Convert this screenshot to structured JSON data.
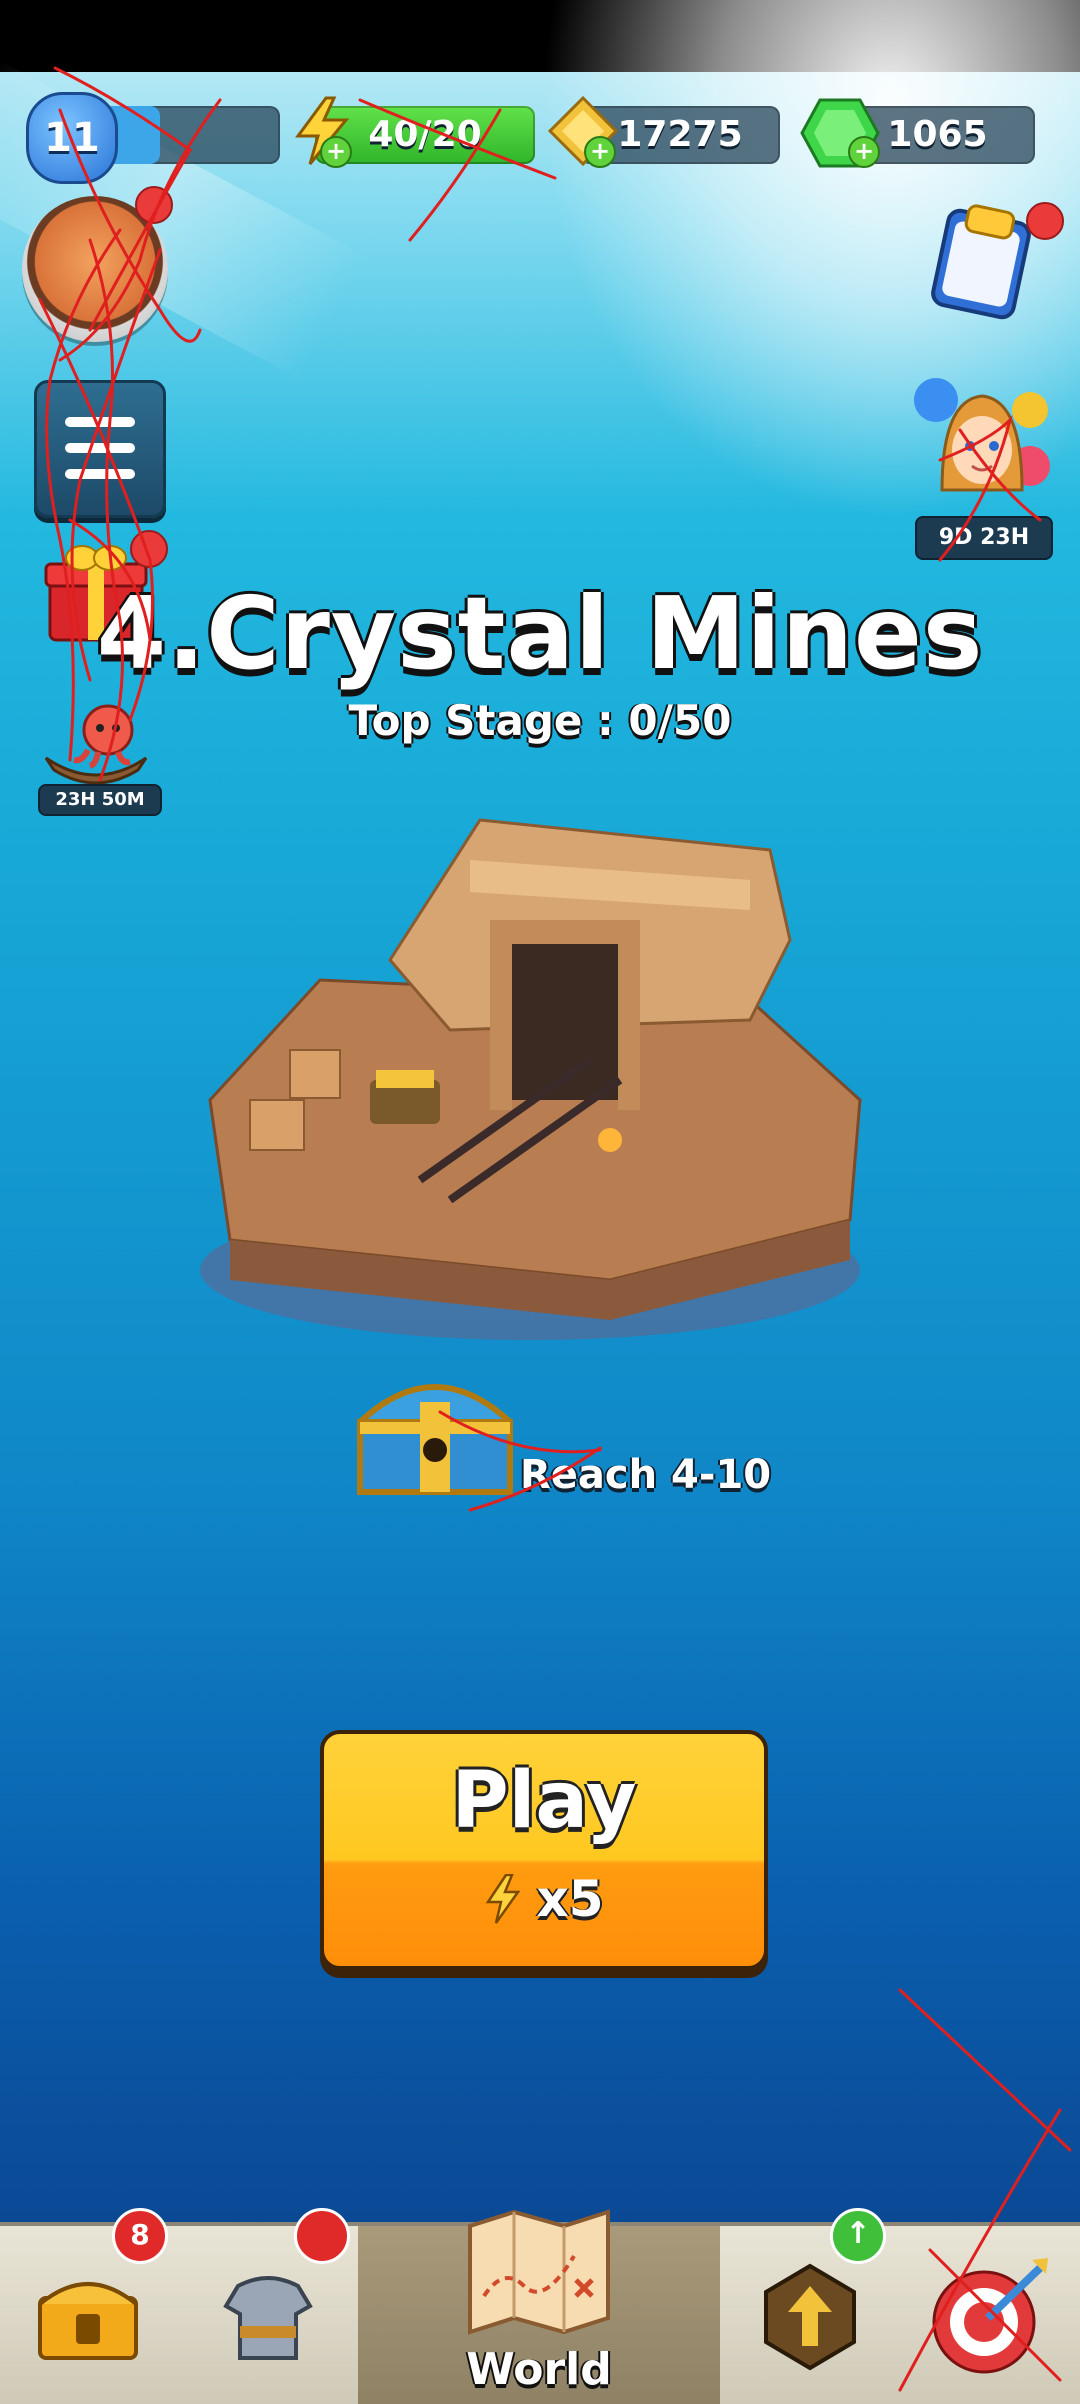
{
  "hud": {
    "level": "11",
    "energy": "40/20",
    "coins": "17275",
    "gems": "1065",
    "plus": "+"
  },
  "left_column": {
    "menu_icon": "hamburger-menu-icon",
    "octopus_timer": "23H 50M"
  },
  "right_column": {
    "event_timer": "9D 23H"
  },
  "world": {
    "title": "4.Crystal Mines",
    "top_stage": "Top Stage : 0/50",
    "chest_goal": "Reach 4-10"
  },
  "play_button": {
    "label": "Play",
    "cost": "x5"
  },
  "nav": {
    "chest_badge": "8",
    "world_label": "World"
  },
  "colors": {
    "play_button_top": "#ffd23a",
    "play_button_bottom": "#ff8e0a",
    "energy_bar": "#2fb52a",
    "notification_red": "#ea3a3a",
    "scribble_red": "#e01f1f"
  }
}
